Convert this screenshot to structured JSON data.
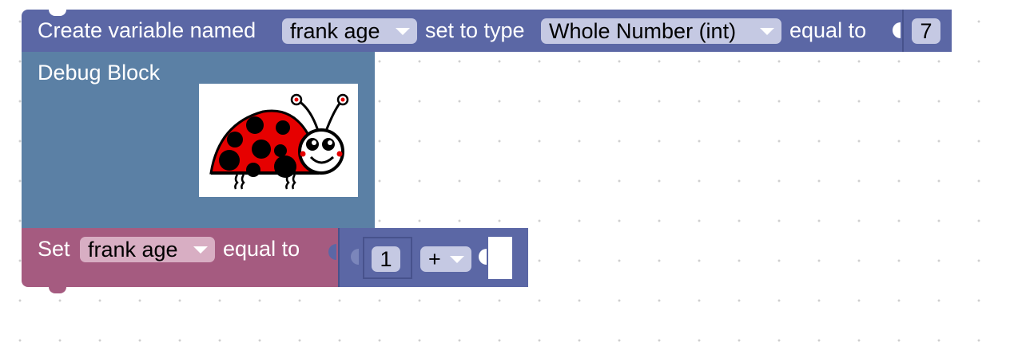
{
  "create_block": {
    "label_create": "Create variable named",
    "variable_name": "frank age",
    "label_type": "set to type",
    "type_value": "Whole Number (int)",
    "label_equal": "equal to",
    "value": "7",
    "color": "#5b67a5"
  },
  "debug_block": {
    "label": "Debug Block",
    "image_icon": "ladybug-icon",
    "color": "#5b80a5"
  },
  "set_block": {
    "label_set": "Set",
    "variable_name": "frank age",
    "label_equal": "equal to",
    "color": "#a55b80"
  },
  "math_block": {
    "left_value": "1",
    "operator": "+",
    "color": "#5b67a5"
  }
}
